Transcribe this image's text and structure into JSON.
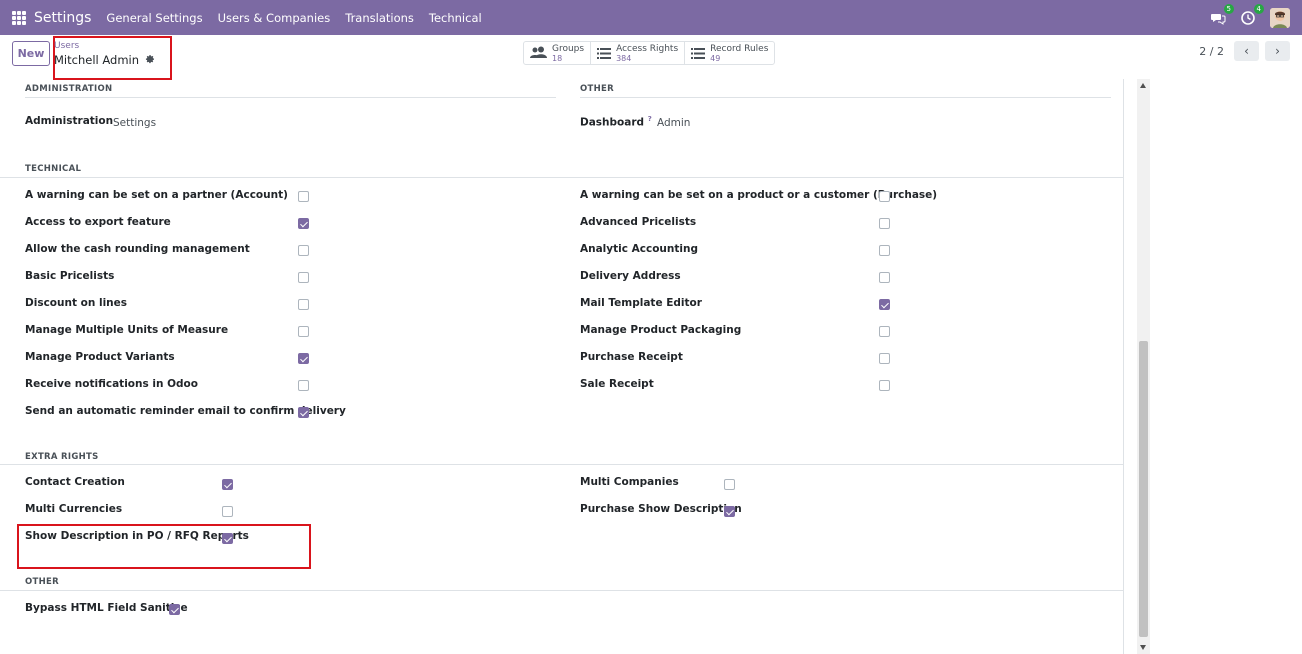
{
  "topbar": {
    "brand": "Settings",
    "menu": [
      "General Settings",
      "Users & Companies",
      "Translations",
      "Technical"
    ],
    "messages_count": "5",
    "activities_count": "4"
  },
  "control": {
    "new_label": "New",
    "breadcrumb_parent": "Users",
    "breadcrumb_current": "Mitchell Admin",
    "stats": [
      {
        "label": "Groups",
        "value": "18"
      },
      {
        "label": "Access Rights",
        "value": "384"
      },
      {
        "label": "Record Rules",
        "value": "49"
      }
    ],
    "pager": "2 / 2"
  },
  "sections": {
    "administration": {
      "title": "ADMINISTRATION",
      "label": "Administration",
      "value": "Settings"
    },
    "other_top": {
      "title": "OTHER",
      "label": "Dashboard",
      "help": "?",
      "value": "Admin"
    },
    "technical": {
      "title": "TECHNICAL",
      "left": [
        {
          "label": "A warning can be set on a partner (Account)",
          "checked": false
        },
        {
          "label": "Access to export feature",
          "checked": true
        },
        {
          "label": "Allow the cash rounding management",
          "checked": false
        },
        {
          "label": "Basic Pricelists",
          "checked": false
        },
        {
          "label": "Discount on lines",
          "checked": false
        },
        {
          "label": "Manage Multiple Units of Measure",
          "checked": false
        },
        {
          "label": "Manage Product Variants",
          "checked": true
        },
        {
          "label": "Receive notifications in Odoo",
          "checked": false
        },
        {
          "label": "Send an automatic reminder email to confirm delivery",
          "checked": true
        }
      ],
      "right": [
        {
          "label": "A warning can be set on a product or a customer (Purchase)",
          "checked": false
        },
        {
          "label": "Advanced Pricelists",
          "checked": false
        },
        {
          "label": "Analytic Accounting",
          "checked": false
        },
        {
          "label": "Delivery Address",
          "checked": false
        },
        {
          "label": "Mail Template Editor",
          "checked": true
        },
        {
          "label": "Manage Product Packaging",
          "checked": false
        },
        {
          "label": "Purchase Receipt",
          "checked": false
        },
        {
          "label": "Sale Receipt",
          "checked": false
        }
      ]
    },
    "extra_rights": {
      "title": "EXTRA RIGHTS",
      "left": [
        {
          "label": "Contact Creation",
          "checked": true
        },
        {
          "label": "Multi Currencies",
          "checked": false
        },
        {
          "label": "Show Description in PO / RFQ Reports",
          "checked": true
        }
      ],
      "right": [
        {
          "label": "Multi Companies",
          "checked": false
        },
        {
          "label": "Purchase Show Description",
          "checked": true
        }
      ]
    },
    "other_bottom": {
      "title": "OTHER",
      "items": [
        {
          "label": "Bypass HTML Field Sanitize",
          "checked": true
        }
      ]
    }
  },
  "colors": {
    "brand": "#7c6aa3",
    "highlight": "#d9141c"
  }
}
